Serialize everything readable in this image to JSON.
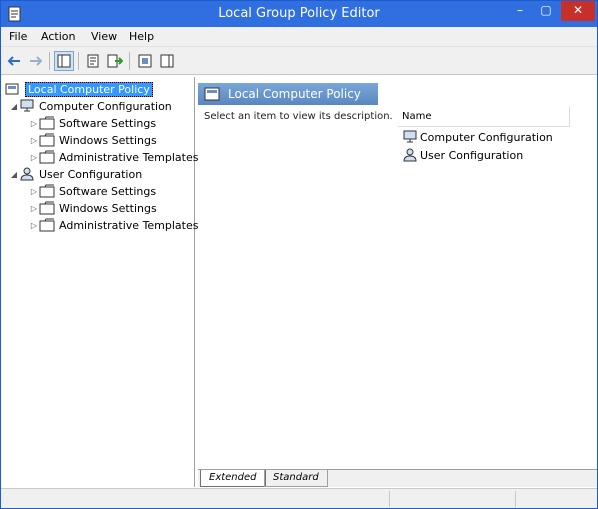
{
  "window": {
    "title": "Local Group Policy Editor",
    "controls": {
      "minimize": "–",
      "maximize": "▢",
      "close": "✕"
    }
  },
  "menu": {
    "items": [
      "File",
      "Action",
      "View",
      "Help"
    ]
  },
  "toolbar": {
    "buttons": [
      "back-arrow-icon",
      "forward-arrow-icon",
      "show-hide-tree-icon",
      "properties-icon",
      "export-list-icon",
      "help-icon",
      "show-hide-action-pane-icon"
    ]
  },
  "tree": {
    "root": "Local Computer Policy",
    "computer_config": "Computer Configuration",
    "user_config": "User Configuration",
    "software_settings": "Software Settings",
    "windows_settings": "Windows Settings",
    "admin_templates": "Administrative Templates",
    "expanded_arrow": "◢",
    "collapsed_arrow": "▷"
  },
  "details": {
    "header": "Local Computer Policy",
    "description": "Select an item to view its description.",
    "column_name": "Name",
    "items": [
      "Computer Configuration",
      "User Configuration"
    ]
  },
  "tabs": {
    "extended": "Extended",
    "standard": "Standard"
  }
}
